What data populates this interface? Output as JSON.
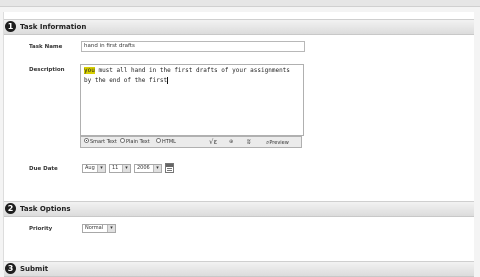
{
  "sections": [
    {
      "number": "1",
      "title": "Task Information"
    },
    {
      "number": "2",
      "title": "Task Options"
    },
    {
      "number": "3",
      "title": "Submit"
    }
  ],
  "task_info": {
    "task_name_label": "Task Name",
    "task_name_value": "hand in first drafts",
    "description_label": "Description",
    "description_highlight": "you",
    "description_text": " must all hand in the first drafts of your assignments\nby the end of the first",
    "editor_modes": [
      "Smart Text",
      "Plain Text",
      "HTML"
    ],
    "editor_mode_selected": "Smart Text",
    "toolbar_icons": [
      "math-root-icon",
      "attachment-icon",
      "spellcheck-icon"
    ],
    "preview_label": "Preview",
    "due_date_label": "Due Date",
    "due_month": "Aug",
    "due_day": "11",
    "due_year": "2006"
  },
  "task_options": {
    "priority_label": "Priority",
    "priority_value": "Normal"
  },
  "colors": {
    "highlight": "#d8d000",
    "section_badge": "#1e1e1e"
  }
}
